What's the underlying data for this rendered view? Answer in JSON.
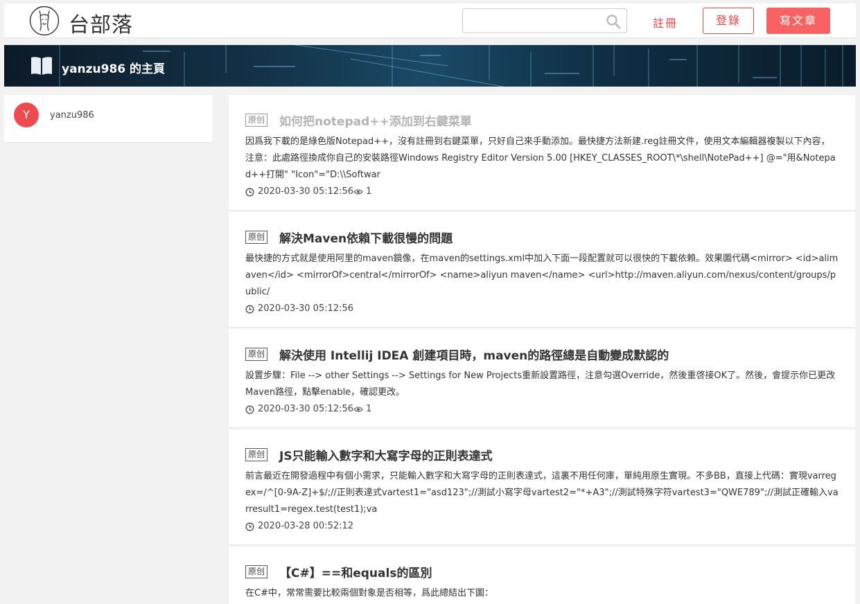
{
  "header": {
    "brand": "台部落",
    "search_placeholder": "",
    "register_label": "註冊",
    "login_label": "登錄",
    "write_label": "寫文章",
    "accent_color": "#e0474c"
  },
  "banner": {
    "title": "yanzu986 的主頁"
  },
  "sidebar": {
    "avatar_letter": "Y",
    "username": "yanzu986"
  },
  "posts": [
    {
      "tag": "原创",
      "title": "如何把notepad++添加到右鍵菜單",
      "visited": true,
      "excerpt": "因爲我下載的是綠色版Notepad++，沒有註冊到右鍵菜單，只好自己來手動添加。最快捷方法新建.reg註冊文件，使用文本編輯器複製以下內容，注意：此處路徑換成你自己的安裝路徑Windows Registry Editor Version 5.00 [HKEY_CLASSES_ROOT\\*\\shell\\NotePad++] @=\"用&Notepad++打開\" \"Icon\"=\"D:\\\\Softwar",
      "date": "2020-03-30 05:12:56",
      "views": "1"
    },
    {
      "tag": "原创",
      "title": "解決Maven依賴下載很慢的問題",
      "visited": false,
      "excerpt": "最快捷的方式就是使用阿里的maven鏡像，在maven的settings.xml中加入下面一段配置就可以很快的下載依賴。效果圖代碼<mirror> <id>alimaven</id> <mirrorOf>central</mirrorOf> <name>aliyun maven</name> <url>http://maven.aliyun.com/nexus/content/groups/public/",
      "date": "2020-03-30 05:12:56",
      "views": ""
    },
    {
      "tag": "原创",
      "title": "解決使用 Intellij IDEA 創建項目時，maven的路徑總是自動變成默認的",
      "visited": false,
      "excerpt": "設置步驟：File --> other Settings --> Settings for New Projects重新設置路徑，注意勾選Override，然後重啓接OK了。然後，會提示你已更改Maven路徑，點擊enable，確認更改。",
      "date": "2020-03-30 05:12:56",
      "views": "1"
    },
    {
      "tag": "原创",
      "title": "JS只能輸入數字和大寫字母的正則表達式",
      "visited": false,
      "excerpt": "前言最近在開發過程中有個小需求，只能輸入數字和大寫字母的正則表達式，這裏不用任何庫，單純用原生實現。不多BB，直接上代碼：實現varregex=/^[0-9A-Z]+$/;//正則表達式vartest1=\"asd123\";//測試小寫字母vartest2=\"*+A3\";//測試特殊字符vartest3=\"QWE789\";//測試正確輸入varresult1=regex.test(test1);va",
      "date": "2020-03-28 00:52:12",
      "views": ""
    },
    {
      "tag": "原创",
      "title": "【C#】==和equals的區別",
      "visited": false,
      "excerpt": "在C#中，常常需要比較兩個對象是否相等，爲此總結出下圖：",
      "date": "",
      "views": ""
    }
  ]
}
